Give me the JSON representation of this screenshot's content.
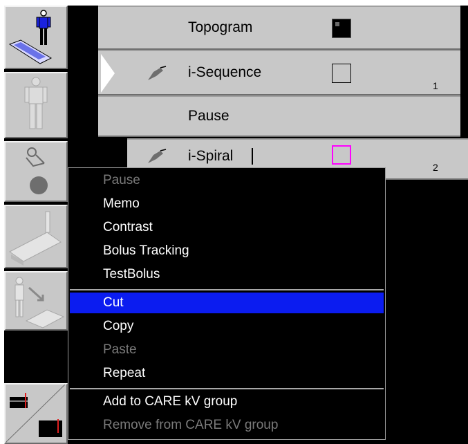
{
  "scan_list": {
    "rows": [
      {
        "label": "Topogram",
        "number": ""
      },
      {
        "label": "i-Sequence",
        "number": "1"
      },
      {
        "label": "Pause",
        "number": ""
      },
      {
        "label": "i-Spiral",
        "number": "2"
      }
    ]
  },
  "toolbar": {
    "buttons": [
      {
        "icon": "patient-keyboard-icon"
      },
      {
        "icon": "patient-figure-icon"
      },
      {
        "icon": "contrast-bolus-icon"
      },
      {
        "icon": "patient-table-icon"
      },
      {
        "icon": "patient-transfer-icon"
      },
      {
        "icon": "care-kv-split-icon"
      }
    ]
  },
  "context_menu": {
    "items": [
      {
        "label": "Pause",
        "enabled": false,
        "selected": false
      },
      {
        "label": "Memo",
        "enabled": true,
        "selected": false
      },
      {
        "label": "Contrast",
        "enabled": true,
        "selected": false
      },
      {
        "label": "Bolus Tracking",
        "enabled": true,
        "selected": false
      },
      {
        "label": "TestBolus",
        "enabled": true,
        "selected": false
      },
      {
        "label": "Cut",
        "enabled": true,
        "selected": true
      },
      {
        "label": "Copy",
        "enabled": true,
        "selected": false
      },
      {
        "label": "Paste",
        "enabled": false,
        "selected": false
      },
      {
        "label": "Repeat",
        "enabled": true,
        "selected": false
      },
      {
        "label": "Add to CARE kV group",
        "enabled": true,
        "selected": false
      },
      {
        "label": "Remove from CARE kV group",
        "enabled": false,
        "selected": false
      }
    ]
  },
  "colors": {
    "selection": "#0b1cf0",
    "panel_gray": "#c8c8c8",
    "magenta_box": "#ff00ff",
    "disabled_text": "#7a7a7a"
  }
}
